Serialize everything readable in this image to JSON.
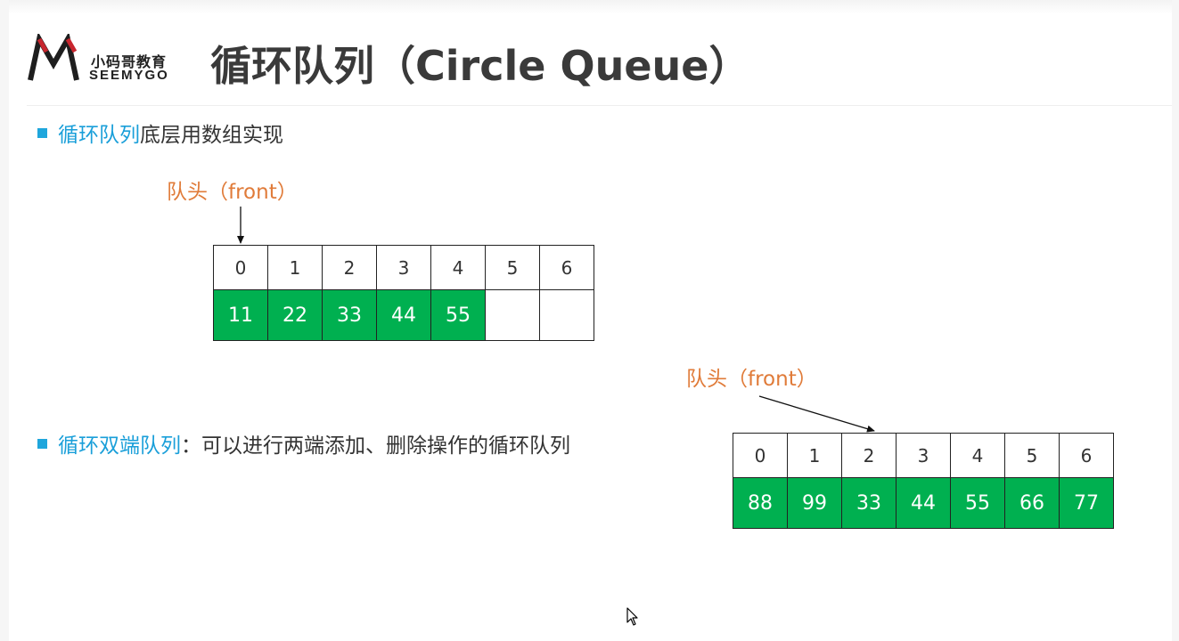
{
  "logo": {
    "cn": "小码哥教育",
    "en": "SEEMYGO"
  },
  "title": "循环队列（Circle Queue）",
  "bullets": [
    {
      "keyword": "循环队列",
      "rest": "底层用数组实现"
    },
    {
      "keyword": "循环双端队列",
      "rest": "：可以进行两端添加、删除操作的循环队列"
    }
  ],
  "front_label": "队头（front）",
  "colors": {
    "accent": "#1a9fd9",
    "front": "#e07b39",
    "filled": "#00b050"
  },
  "array1": {
    "indices": [
      "0",
      "1",
      "2",
      "3",
      "4",
      "5",
      "6"
    ],
    "values": [
      "11",
      "22",
      "33",
      "44",
      "55",
      "",
      ""
    ]
  },
  "array2": {
    "indices": [
      "0",
      "1",
      "2",
      "3",
      "4",
      "5",
      "6"
    ],
    "values": [
      "88",
      "99",
      "33",
      "44",
      "55",
      "66",
      "77"
    ]
  }
}
